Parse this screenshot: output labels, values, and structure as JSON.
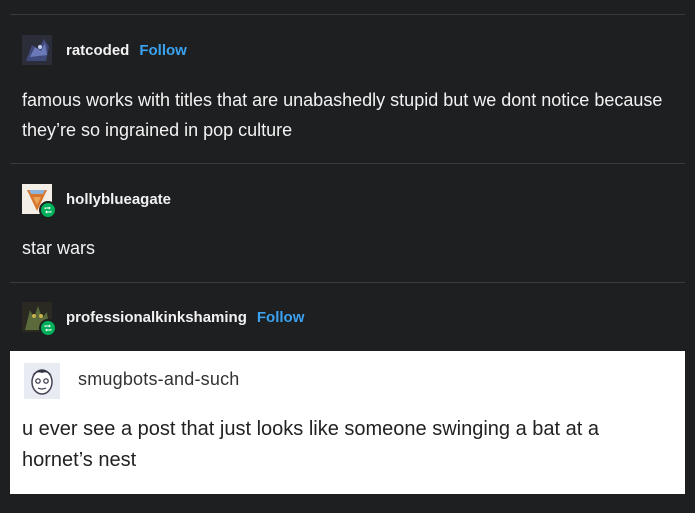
{
  "posts": [
    {
      "username": "ratcoded",
      "follow_label": "Follow",
      "text": "famous works with titles that are unabashedly stupid but we dont notice because they’re so ingrained in pop culture"
    },
    {
      "username": "hollyblueagate",
      "text": "star wars"
    },
    {
      "username": "professionalkinkshaming",
      "follow_label": "Follow"
    }
  ],
  "screenshot_post": {
    "username": "smugbots-and-such",
    "text": "u ever see a post that just looks like someone swinging a bat at a hornet’s nest"
  },
  "colors": {
    "background": "#1e1f21",
    "follow_link": "#3aa2f0",
    "reblog_badge": "#00b05a"
  },
  "icons": {
    "reblog": "reblog-icon"
  }
}
